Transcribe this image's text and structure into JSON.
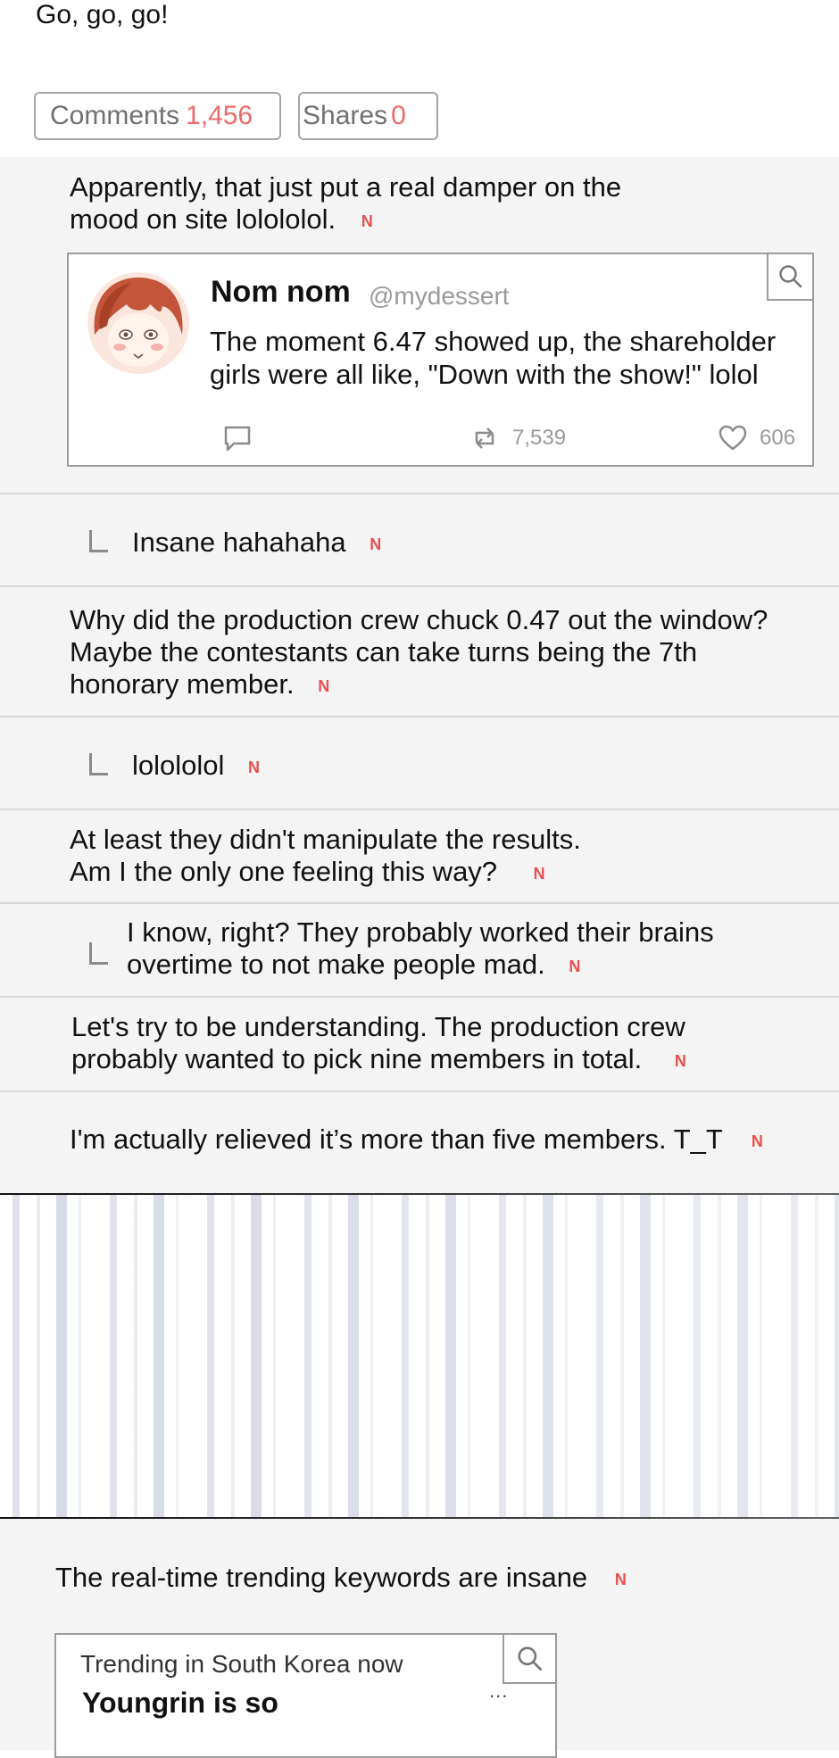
{
  "post": {
    "closing_line": "Go, go, go!"
  },
  "stats": {
    "comments_label": "Comments",
    "comments_count": "1,456",
    "shares_label": "Shares",
    "shares_count": "0"
  },
  "new_badge": "N",
  "comments": [
    {
      "line1": "Apparently, that just put a real damper on the",
      "line2": "mood on site lolololol."
    },
    {
      "text": "Insane hahahaha"
    },
    {
      "line1": "Why did the production crew chuck 0.47 out the window?",
      "line2": "Maybe the contestants can take turns being the 7th",
      "line3": "honorary member."
    },
    {
      "text": "lolololol"
    },
    {
      "line1": "At least they didn't manipulate the results.",
      "line2": "Am I the only one feeling this way?"
    },
    {
      "line1": "I know, right? They probably worked their brains",
      "line2": "overtime to not make people mad."
    },
    {
      "line1": "Let's try to be understanding. The production crew",
      "line2": "probably wanted to pick nine members in total."
    },
    {
      "text": "I'm actually relieved it’s more than five members. T_T"
    },
    {
      "text": "The real-time trending keywords are insane"
    }
  ],
  "tweet": {
    "name": "Nom nom",
    "handle": "@mydessert",
    "line1": "The moment 6.47 showed up, the shareholder",
    "line2": "girls were all like, \"Down with the show!\" lolol",
    "retweets": "7,539",
    "likes": "606",
    "icons": [
      "search-icon",
      "comment-icon",
      "retweet-icon",
      "heart-icon"
    ]
  },
  "trending": {
    "header": "Trending in South Korea now",
    "keyword": "Youngrin is so",
    "more": "..."
  },
  "colors": {
    "badge": "#e84f4f",
    "count": "#ec6a6a",
    "panel": "#f4f4f4"
  }
}
